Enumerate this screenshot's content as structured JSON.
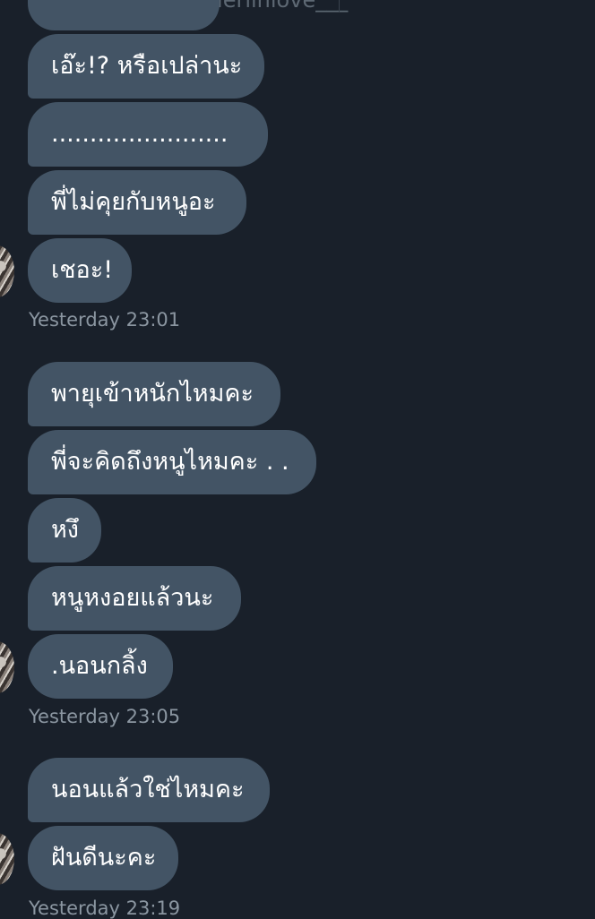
{
  "header": {
    "handle": "@Merlinlove___"
  },
  "messages": [
    {
      "text": "เอ๊ะ!? หรือเปล่านะ"
    },
    {
      "text": "......................."
    },
    {
      "text": "พี่ไม่คุยกับหนูอะ"
    },
    {
      "text": "เชอะ!"
    },
    {
      "text": "พายุเข้าหนักไหมคะ"
    },
    {
      "text": "พี่จะคิดถึงหนูไหมคะ . ."
    },
    {
      "text": "หงึ"
    },
    {
      "text": "หนูหงอยแล้วนะ"
    },
    {
      "text": ".นอนกลิ้ง"
    },
    {
      "text": "นอนแล้วใช่ไหมคะ"
    },
    {
      "text": "ฝันดีนะคะ"
    }
  ],
  "timestamps": [
    "Yesterday 23:01",
    "Yesterday 23:05",
    "Yesterday 23:19"
  ],
  "colors": {
    "background": "#19202a",
    "bubble": "#435465",
    "timestamp": "#8b96a1"
  }
}
